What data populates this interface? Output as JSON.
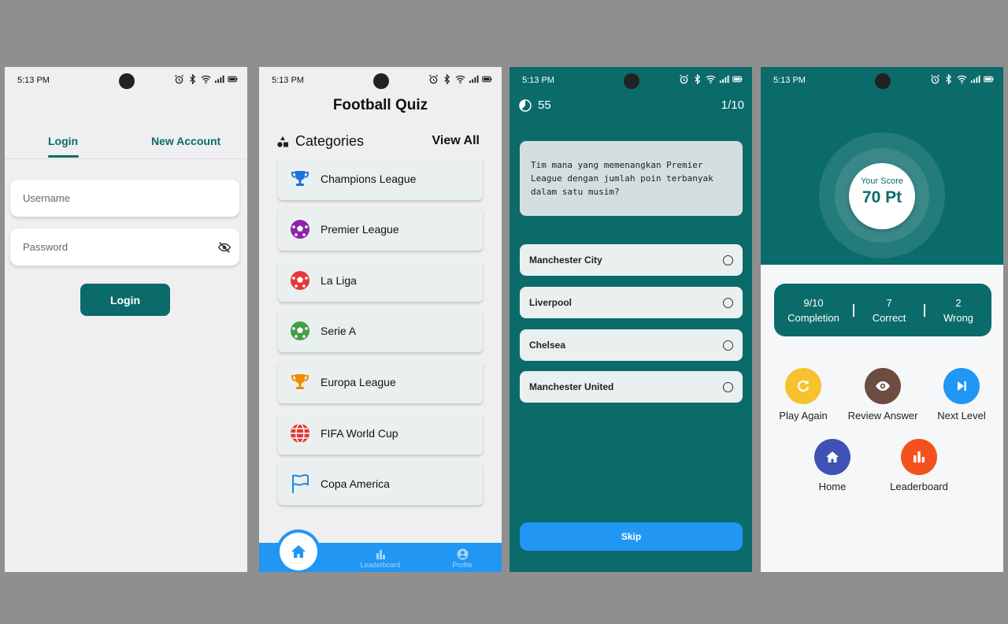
{
  "status_bar": {
    "time": "5:13 PM"
  },
  "screen_login": {
    "tabs": [
      "Login",
      "New Account"
    ],
    "username_placeholder": "Username",
    "password_placeholder": "Password",
    "login_button": "Login",
    "accent_color": "#0b6b6a"
  },
  "screen_categories": {
    "title": "Football Quiz",
    "section_title": "Categories",
    "view_all": "View All",
    "categories": [
      {
        "label": "Champions League",
        "icon": "trophy-icon",
        "color": "#1e73d8"
      },
      {
        "label": "Premier League",
        "icon": "soccer-ball-icon",
        "color": "#8e24aa"
      },
      {
        "label": "La Liga",
        "icon": "soccer-ball-icon",
        "color": "#e53935"
      },
      {
        "label": "Serie A",
        "icon": "soccer-ball-icon",
        "color": "#43a047"
      },
      {
        "label": "Europa League",
        "icon": "trophy-icon",
        "color": "#ef8c00"
      },
      {
        "label": "FIFA World Cup",
        "icon": "globe-icon",
        "color": "#e53935"
      },
      {
        "label": "Copa America",
        "icon": "flag-icon",
        "color": "#1e88e5"
      }
    ],
    "bottom_nav": {
      "leaderboard": "Leaderboard",
      "profile": "Profile"
    },
    "nav_color": "#2196f3"
  },
  "screen_question": {
    "timer": "55",
    "progress": "1/10",
    "question": "Tim mana yang memenangkan Premier League dengan jumlah poin terbanyak dalam satu musim?",
    "options": [
      "Manchester City",
      "Liverpool",
      "Chelsea",
      "Manchester United"
    ],
    "skip_button": "Skip"
  },
  "screen_result": {
    "score_label": "Your Score",
    "score_value": "70 Pt",
    "stats": [
      {
        "value": "9/10",
        "label": "Completion"
      },
      {
        "value": "7",
        "label": "Correct"
      },
      {
        "value": "2",
        "label": "Wrong"
      }
    ],
    "actions": [
      {
        "label": "Play Again",
        "icon": "replay-icon",
        "color": "#f6c22d"
      },
      {
        "label": "Review Answer",
        "icon": "eye-icon",
        "color": "#6d4c41"
      },
      {
        "label": "Next Level",
        "icon": "skip-next-icon",
        "color": "#2196f3"
      },
      {
        "label": "Home",
        "icon": "home-icon",
        "color": "#3f51b5"
      },
      {
        "label": "Leaderboard",
        "icon": "bar-chart-icon",
        "color": "#f4511e"
      }
    ]
  }
}
